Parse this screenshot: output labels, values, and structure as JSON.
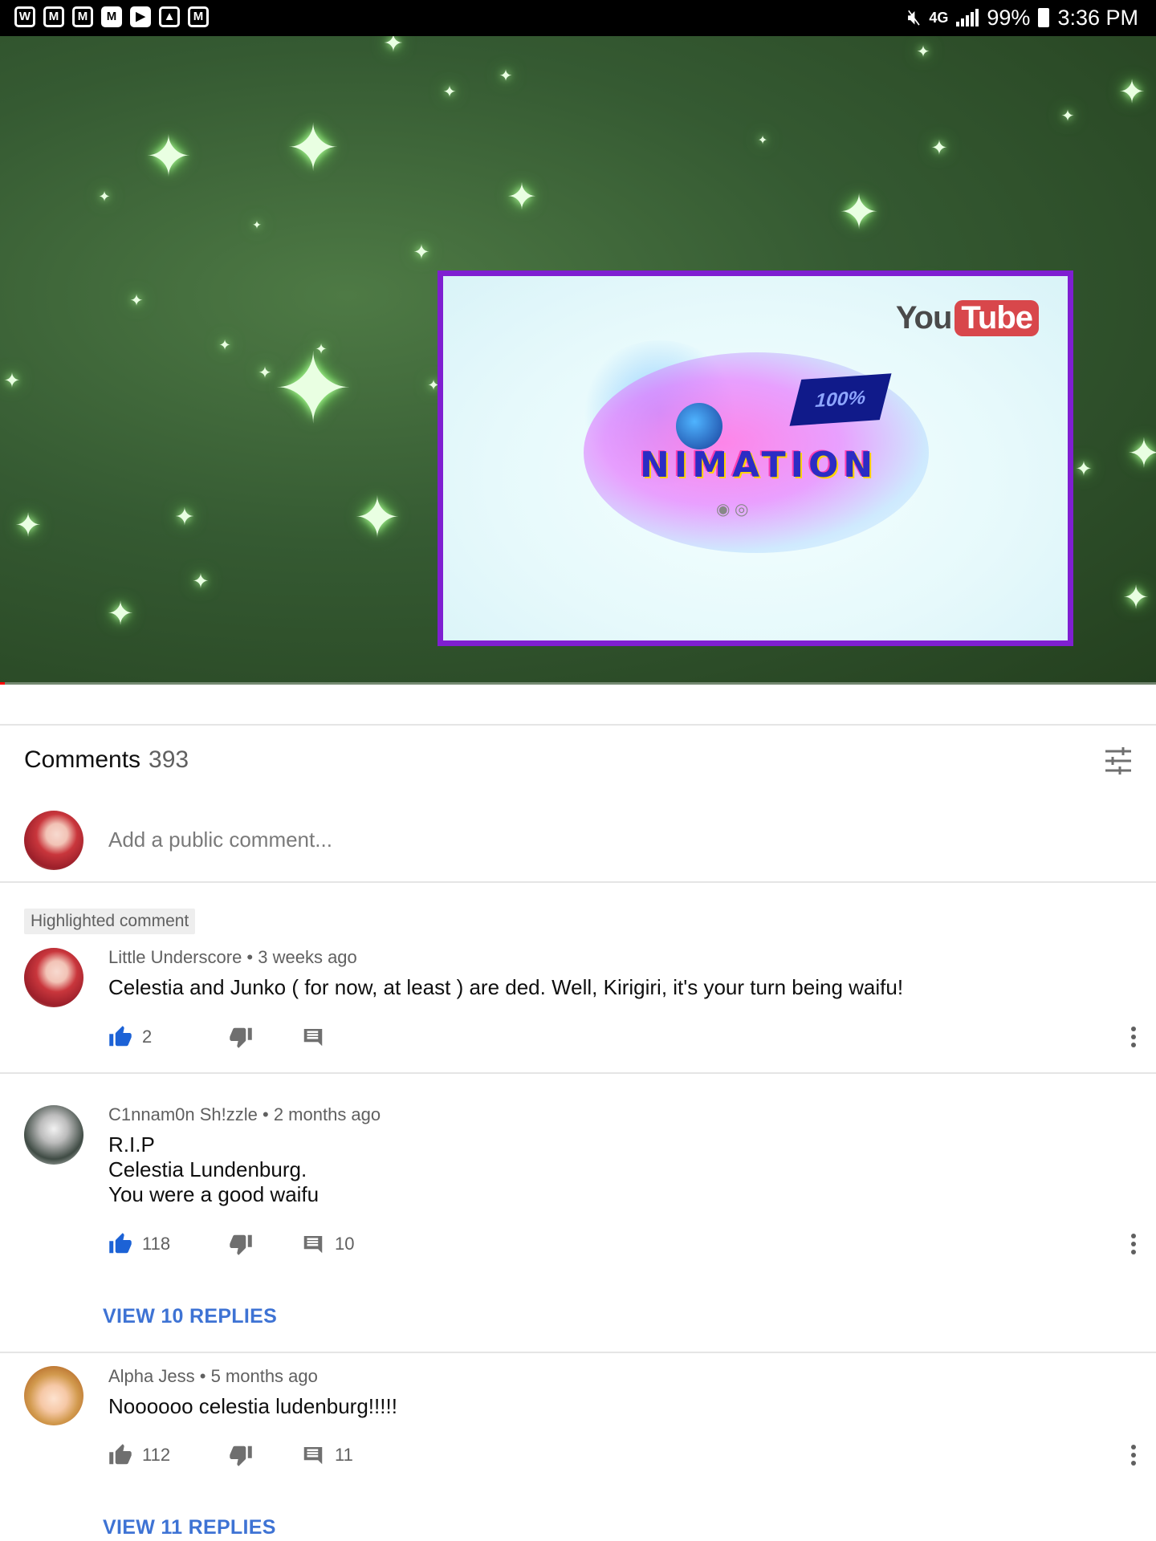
{
  "status_bar": {
    "network": "4G",
    "battery": "99%",
    "time": "3:36 PM"
  },
  "video": {
    "logo_you": "You",
    "logo_tube": "Tube",
    "inset_badge": "100%",
    "inset_title": "NIMATION",
    "progress_fraction": 0.004
  },
  "comments": {
    "title": "Comments",
    "count": "393",
    "add_placeholder": "Add a public comment...",
    "highlight_label": "Highlighted comment",
    "items": [
      {
        "author": "Little Underscore",
        "time": "3 weeks ago",
        "text": "Celestia and Junko ( for now, at least ) are ded. Well, Kirigiri, it's your turn being waifu!",
        "likes": "2",
        "replies": "",
        "liked": true
      },
      {
        "author": "C1nnam0n Sh!zzle",
        "time": "2 months ago",
        "text_lines": [
          "R.I.P",
          "Celestia Lundenburg.",
          "You were a good waifu"
        ],
        "likes": "118",
        "replies": "10",
        "view_replies": "VIEW 10 REPLIES",
        "liked": true
      },
      {
        "author": "Alpha Jess",
        "time": "5 months ago",
        "text": "Noooooo celestia ludenburg!!!!!",
        "likes": "112",
        "replies": "11",
        "view_replies": "VIEW 11 REPLIES",
        "liked": false
      }
    ]
  },
  "colors": {
    "accent_blue": "#3e73d4",
    "like_blue": "#1c62d6",
    "icon_gray": "#6f6f6f",
    "inset_border": "#7f1fd1"
  }
}
